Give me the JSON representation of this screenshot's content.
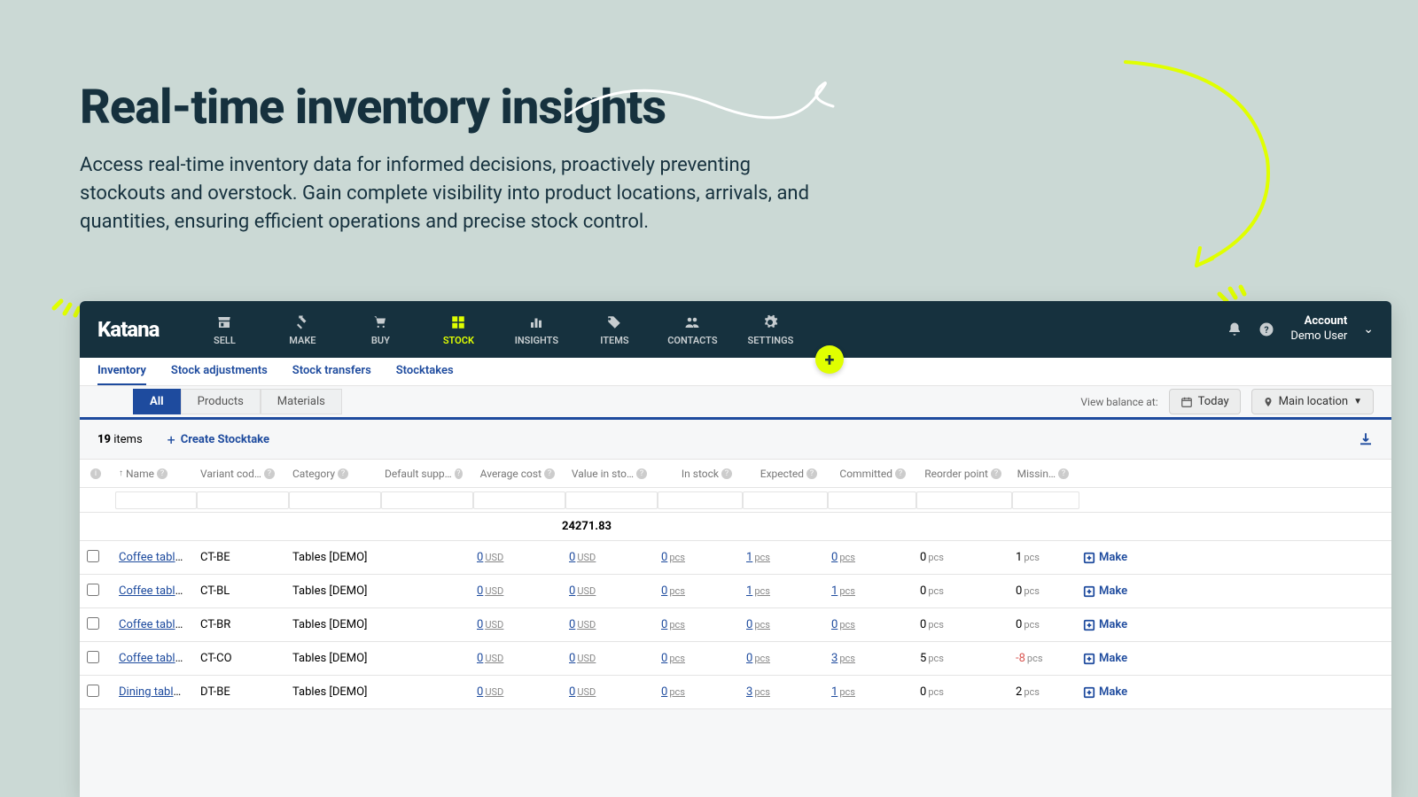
{
  "hero": {
    "title": "Real-time inventory insights",
    "desc": "Access real-time inventory data for informed decisions, proactively preventing stockouts and overstock. Gain complete visibility into product locations, arrivals, and quantities, ensuring efficient operations and precise stock control."
  },
  "brand": "Katana",
  "nav": [
    {
      "label": "SELL",
      "icon": "store"
    },
    {
      "label": "MAKE",
      "icon": "hammer"
    },
    {
      "label": "BUY",
      "icon": "cart"
    },
    {
      "label": "STOCK",
      "icon": "grid",
      "active": true
    },
    {
      "label": "INSIGHTS",
      "icon": "chart"
    },
    {
      "label": "ITEMS",
      "icon": "tag"
    },
    {
      "label": "CONTACTS",
      "icon": "people"
    },
    {
      "label": "SETTINGS",
      "icon": "gear"
    }
  ],
  "account": {
    "title": "Account",
    "user": "Demo User"
  },
  "subnav": [
    {
      "label": "Inventory",
      "active": true
    },
    {
      "label": "Stock adjustments"
    },
    {
      "label": "Stock transfers"
    },
    {
      "label": "Stocktakes"
    }
  ],
  "tabs": [
    {
      "label": "All",
      "active": true
    },
    {
      "label": "Products"
    },
    {
      "label": "Materials"
    }
  ],
  "balance_label": "View balance at:",
  "today_btn": "Today",
  "location_btn": "Main location",
  "items_count": "19",
  "items_label": "items",
  "create_stocktake": "Create Stocktake",
  "columns": {
    "name": "Name",
    "vcode": "Variant cod…",
    "cat": "Category",
    "sup": "Default supp…",
    "avg": "Average cost",
    "val": "Value in sto…",
    "stk": "In stock",
    "exp": "Expected",
    "com": "Committed",
    "rop": "Reorder point",
    "mis": "Missin…"
  },
  "sum_value": "24271.83",
  "make_label": "Make",
  "rows": [
    {
      "name": "Coffee table [D",
      "vcode": "CT-BE",
      "cat": "Tables [DEMO]",
      "avg": "0",
      "val": "0",
      "stk": "0",
      "exp": "1",
      "com": "0",
      "rop": "0",
      "mis": "1"
    },
    {
      "name": "Coffee table [D",
      "vcode": "CT-BL",
      "cat": "Tables [DEMO]",
      "avg": "0",
      "val": "0",
      "stk": "0",
      "exp": "1",
      "com": "1",
      "rop": "0",
      "mis": "0"
    },
    {
      "name": "Coffee table [D",
      "vcode": "CT-BR",
      "cat": "Tables [DEMO]",
      "avg": "0",
      "val": "0",
      "stk": "0",
      "exp": "0",
      "com": "0",
      "rop": "0",
      "mis": "0"
    },
    {
      "name": "Coffee table [D",
      "vcode": "CT-CO",
      "cat": "Tables [DEMO]",
      "avg": "0",
      "val": "0",
      "stk": "0",
      "exp": "0",
      "com": "3",
      "rop": "5",
      "mis": "-8"
    },
    {
      "name": "Dining table [D",
      "vcode": "DT-BE",
      "cat": "Tables [DEMO]",
      "avg": "0",
      "val": "0",
      "stk": "0",
      "exp": "3",
      "com": "1",
      "rop": "0",
      "mis": "2"
    }
  ]
}
